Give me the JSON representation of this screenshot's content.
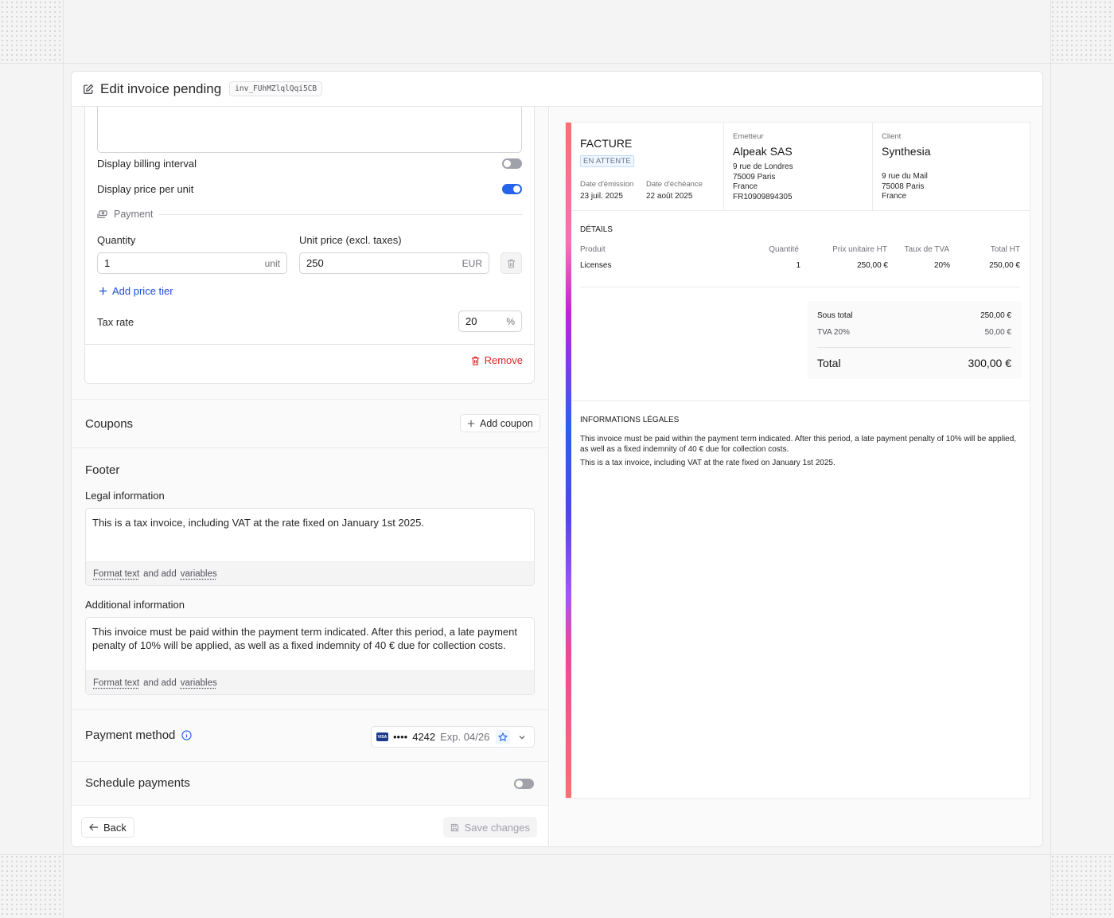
{
  "header": {
    "title": "Edit invoice pending",
    "invoice_id": "inv_FUhMZlqlQqi5CB"
  },
  "item": {
    "display_billing_interval_label": "Display billing interval",
    "display_billing_interval_on": false,
    "display_price_per_unit_label": "Display price per unit",
    "display_price_per_unit_on": true,
    "payment_section_label": "Payment",
    "quantity_label": "Quantity",
    "quantity_value": "1",
    "quantity_suffix": "unit",
    "unit_price_label": "Unit price (excl. taxes)",
    "unit_price_value": "250",
    "unit_price_suffix": "EUR",
    "add_price_tier_label": "Add price tier",
    "tax_rate_label": "Tax rate",
    "tax_rate_value": "20",
    "tax_rate_suffix": "%",
    "remove_label": "Remove"
  },
  "coupons": {
    "title": "Coupons",
    "add_label": "Add coupon"
  },
  "footer": {
    "title": "Footer",
    "legal_label": "Legal information",
    "legal_text": "This is a tax invoice, including VAT at the rate fixed on January 1st 2025.",
    "additional_label": "Additional information",
    "additional_text": "This invoice must be paid within the payment term indicated. After this period, a late payment penalty of 10% will be applied, as well as a fixed indemnity of 40 € due for collection costs.",
    "format_text": "Format text",
    "and_add": "and add",
    "variables": "variables"
  },
  "payment_method": {
    "title": "Payment method",
    "card_brand": "VISA",
    "card_dots": "••••",
    "card_last4": "4242",
    "card_exp": "Exp. 04/26"
  },
  "schedule": {
    "title": "Schedule payments",
    "on": false
  },
  "actions": {
    "back_label": "Back",
    "save_label": "Save changes"
  },
  "invoice_preview": {
    "doc_title": "FACTURE",
    "status": "EN ATTENTE",
    "issue_date_label": "Date d'émission",
    "issue_date": "23 juil. 2025",
    "due_date_label": "Date d'échéance",
    "due_date": "22 août 2025",
    "issuer_label": "Emetteur",
    "issuer_name": "Alpeak SAS",
    "issuer_address": [
      "9 rue de Londres",
      "75009 Paris",
      "France",
      "FR10909894305"
    ],
    "client_label": "Client",
    "client_name": "Synthesia",
    "client_address": [
      "9 rue du Mail",
      "75008 Paris",
      "France"
    ],
    "details_title": "DÉTAILS",
    "columns": [
      "Produit",
      "Quantité",
      "Prix unitaire HT",
      "Taux de TVA",
      "Total HT"
    ],
    "rows": [
      [
        "Licenses",
        "1",
        "250,00 €",
        "20%",
        "250,00 €"
      ]
    ],
    "subtotal_label": "Sous total",
    "subtotal_value": "250,00 €",
    "vat_label": "TVA 20%",
    "vat_value": "50,00 €",
    "total_label": "Total",
    "total_value": "300,00 €",
    "legal_title": "INFORMATIONS LÉGALES",
    "legal_lines": [
      "This invoice must be paid within the payment term indicated. After this period, a late payment penalty of 10% will be applied, as well as a fixed indemnity of 40 € due for collection costs.",
      "This is a tax invoice, including VAT at the rate fixed on January 1st 2025."
    ]
  },
  "colors": {
    "accent_blue": "#2563eb",
    "danger_red": "#dc2626"
  }
}
